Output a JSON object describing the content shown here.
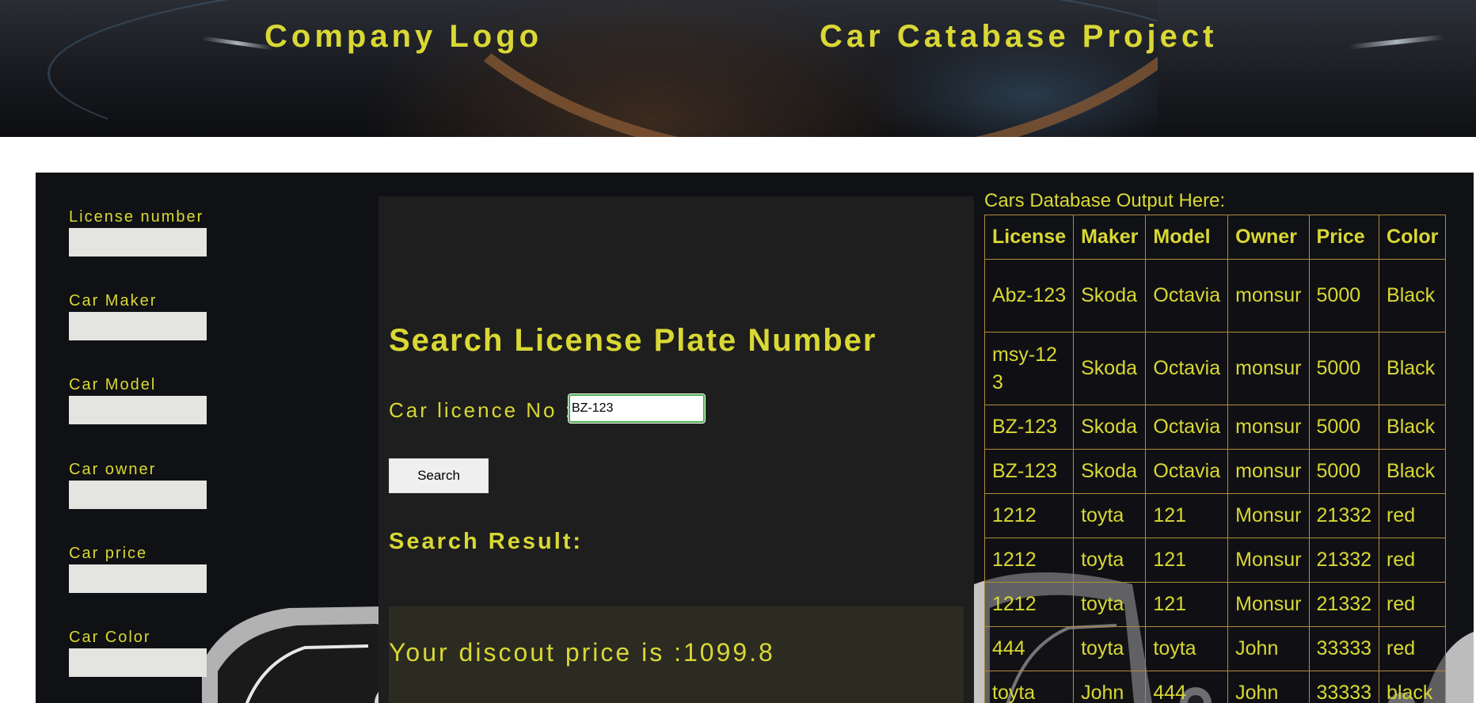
{
  "header": {
    "logo": "Company Logo",
    "project_title": "Car Catabase Project"
  },
  "form": {
    "license_label": "License number",
    "maker_label": "Car Maker",
    "model_label": "Car Model",
    "owner_label": "Car owner",
    "price_label": "Car price",
    "color_label": "Car Color"
  },
  "search": {
    "title": "Search License Plate Number",
    "licence_label": "Car licence No :",
    "licence_value": "BZ-123",
    "button_label": "Search",
    "result_title": "Search Result:",
    "discount_text": "Your discout price is :1099.8"
  },
  "output": {
    "caption": "Cars Database Output Here:",
    "columns": [
      "License",
      "Maker",
      "Model",
      "Owner",
      "Price",
      "Color"
    ],
    "rows": [
      [
        "Abz-123",
        "Skoda",
        "Octavia",
        "monsur",
        "5000",
        "Black"
      ],
      [
        "msy-123",
        "Skoda",
        "Octavia",
        "monsur",
        "5000",
        "Black"
      ],
      [
        "BZ-123",
        "Skoda",
        "Octavia",
        "monsur",
        "5000",
        "Black"
      ],
      [
        "BZ-123",
        "Skoda",
        "Octavia",
        "monsur",
        "5000",
        "Black"
      ],
      [
        "1212",
        "toyta",
        "121",
        "Monsur",
        "21332",
        "red"
      ],
      [
        "1212",
        "toyta",
        "121",
        "Monsur",
        "21332",
        "red"
      ],
      [
        "1212",
        "toyta",
        "121",
        "Monsur",
        "21332",
        "red"
      ],
      [
        "444",
        "toyta",
        "toyta",
        "John",
        "33333",
        "red"
      ],
      [
        "toyta",
        "John",
        "444",
        "John",
        "33333",
        "black"
      ]
    ]
  },
  "colors": {
    "accent": "#d9d834",
    "panel": "#101114",
    "center_panel": "#1e1e1e",
    "table_border": "#b28a3c"
  }
}
